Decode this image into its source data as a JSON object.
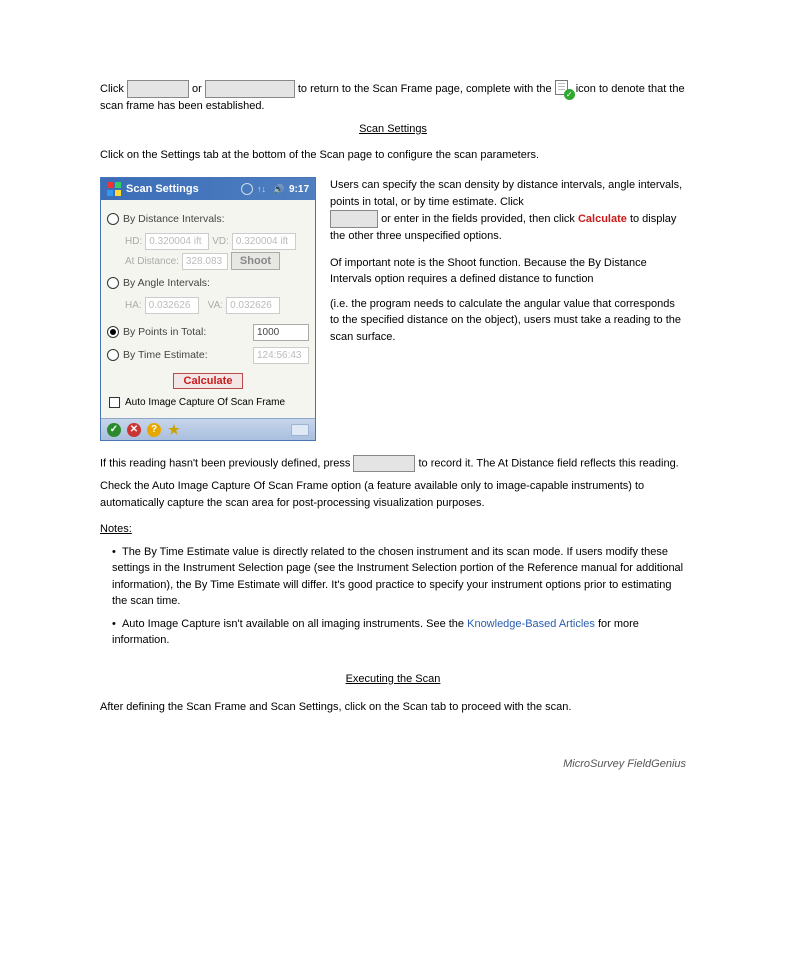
{
  "paragraph_top_a": "Click ",
  "paragraph_top_b": " or ",
  "paragraph_top_c": " to return to the Scan Frame page, complete with the ",
  "paragraph_top_d": " icon to denote that the scan frame has been established.",
  "heading": "Scan Settings",
  "desc": "Click on the Settings tab at the bottom of the Scan page to configure the scan parameters.",
  "side1": "Users can specify the scan density by distance intervals, angle intervals, points in total, or by time estimate. Click",
  "side1b": " or enter in the fields provided, then click ",
  "side1c": "Calculate",
  "side1d": " to display the other three unspecified options.",
  "side2": "Of important note is the Shoot function. Because the By Distance Intervals option requires a defined distance to function ",
  "side3": "(i.e. the program needs to calculate the angular value that corresponds to the specified distance on the object), users must take a reading to the scan surface.",
  "device": {
    "title": "Scan Settings",
    "time": "9:17",
    "opts": {
      "dist": "By Distance Intervals:",
      "angle": "By Angle Intervals:",
      "points": "By Points in Total:",
      "time": "By Time Estimate:"
    },
    "labels": {
      "hd": "HD:",
      "vd": "VD:",
      "atdist": "At Distance:",
      "ha": "HA:",
      "va": "VA:",
      "shoot": "Shoot",
      "calculate": "Calculate",
      "auto": "Auto Image Capture Of Scan Frame"
    },
    "values": {
      "hd": "0.320004 ift",
      "vd": "0.320004 ift",
      "atdist": "328.083",
      "ha": "0.032626",
      "va": "0.032626",
      "points": "1000",
      "time": "124:56:43"
    }
  },
  "after1": "If this reading hasn't been previously defined, press ",
  "after1b": " to record it. The At Distance field reflects this reading.",
  "after2": "Check the Auto Image Capture Of Scan Frame option (a feature available only to image-capable instruments) to automatically capture the scan area for post-processing visualization purposes.",
  "notes_hdr": "Notes:",
  "note1a": "The ",
  "note1b": "By Time Estimate",
  "note1c": " value is directly related to the chosen instrument and its scan mode. If users modify these settings in the Instrument Selection page (see ",
  "note1d": "the Instrument Selection portion of the Reference manual for additional information), the ",
  "note1e": " will differ. It's good practice to specify your instrument options prior to estimating the scan time.",
  "note2a": "Auto Image Capture isn't available on all imaging instruments. See the",
  "note2b": " for more information.",
  "heading2": "Executing the Scan",
  "exec_desc": "After defining the Scan Frame and Scan Settings, click on the Scan tab to proceed with the scan.",
  "link1": "Knowledge-Based Articles",
  "pagenum": "MicroSurvey FieldGenius"
}
